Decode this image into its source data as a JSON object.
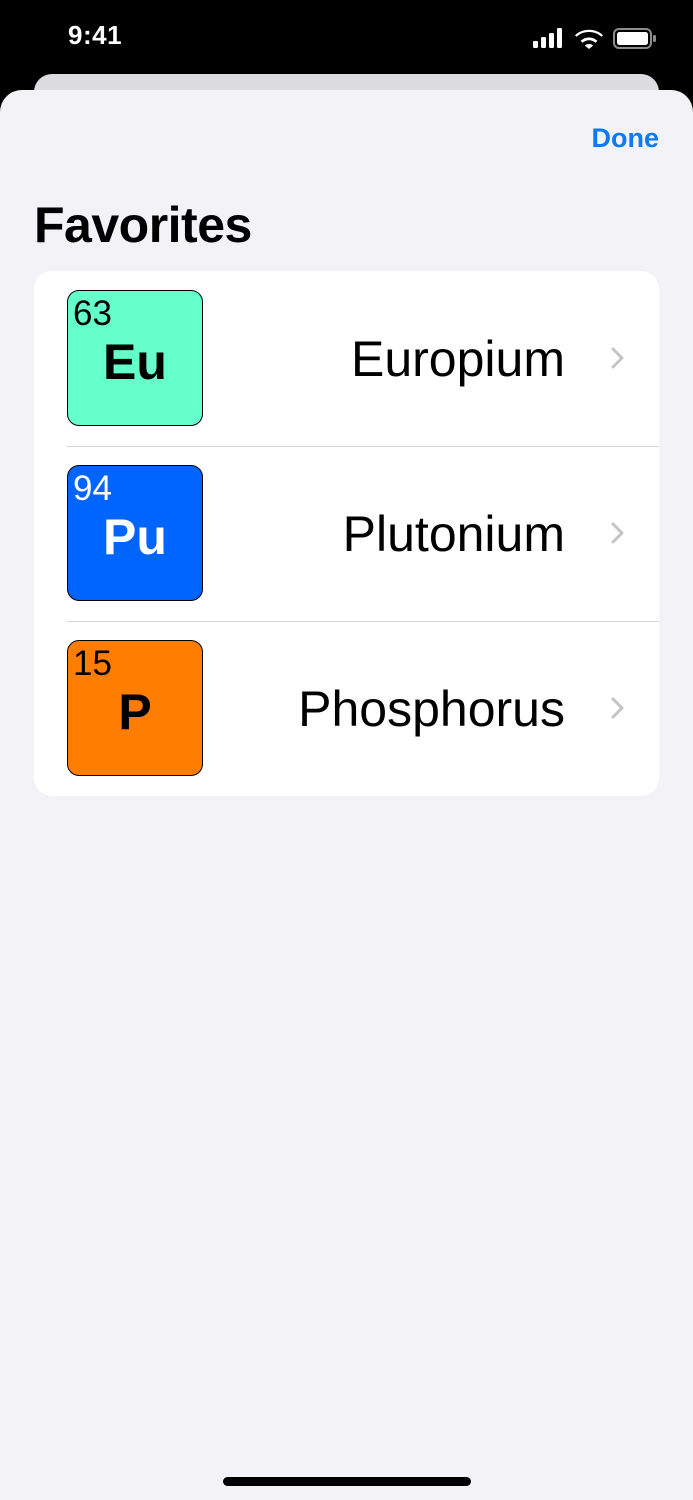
{
  "status_bar": {
    "time": "9:41",
    "icons": [
      "cellular-signal-icon",
      "wifi-icon",
      "battery-icon"
    ]
  },
  "nav": {
    "done_label": "Done",
    "accent_color": "#0a7bf2"
  },
  "title": "Favorites",
  "favorites": [
    {
      "number": "63",
      "symbol": "Eu",
      "name": "Europium",
      "tile_color": "#64ffca",
      "text_color": "#000000"
    },
    {
      "number": "94",
      "symbol": "Pu",
      "name": "Plutonium",
      "tile_color": "#0064ff",
      "text_color": "#ffffff"
    },
    {
      "number": "15",
      "symbol": "P",
      "name": "Phosphorus",
      "tile_color": "#ff7d00",
      "text_color": "#000000"
    }
  ],
  "icons": {
    "row_disclosure": "chevron-right-icon"
  }
}
